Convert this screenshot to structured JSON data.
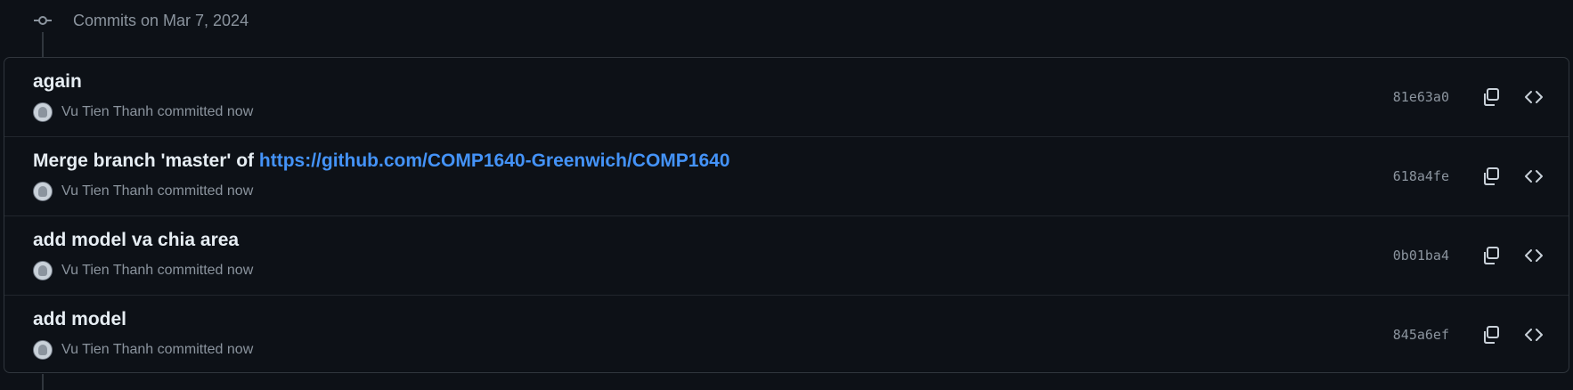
{
  "group": {
    "title": "Commits on Mar 7, 2024",
    "icon": "git-commit-icon"
  },
  "commits": [
    {
      "title": "again",
      "link": "",
      "author": "Vu Tien Thanh",
      "action": "committed",
      "time": "now",
      "sha": "81e63a0"
    },
    {
      "title": "Merge branch 'master' of ",
      "link": "https://github.com/COMP1640-Greenwich/COMP1640",
      "author": "Vu Tien Thanh",
      "action": "committed",
      "time": "now",
      "sha": "618a4fe"
    },
    {
      "title": "add model va chia area",
      "link": "",
      "author": "Vu Tien Thanh",
      "action": "committed",
      "time": "now",
      "sha": "0b01ba4"
    },
    {
      "title": "add model",
      "link": "",
      "author": "Vu Tien Thanh",
      "action": "committed",
      "time": "now",
      "sha": "845a6ef"
    }
  ],
  "icons": {
    "copy": "copy-icon",
    "browse": "code-icon"
  },
  "colors": {
    "background": "#0d1117",
    "border": "#30363d",
    "text": "#e6edf3",
    "muted": "#8b949e",
    "link": "#4493f8"
  }
}
